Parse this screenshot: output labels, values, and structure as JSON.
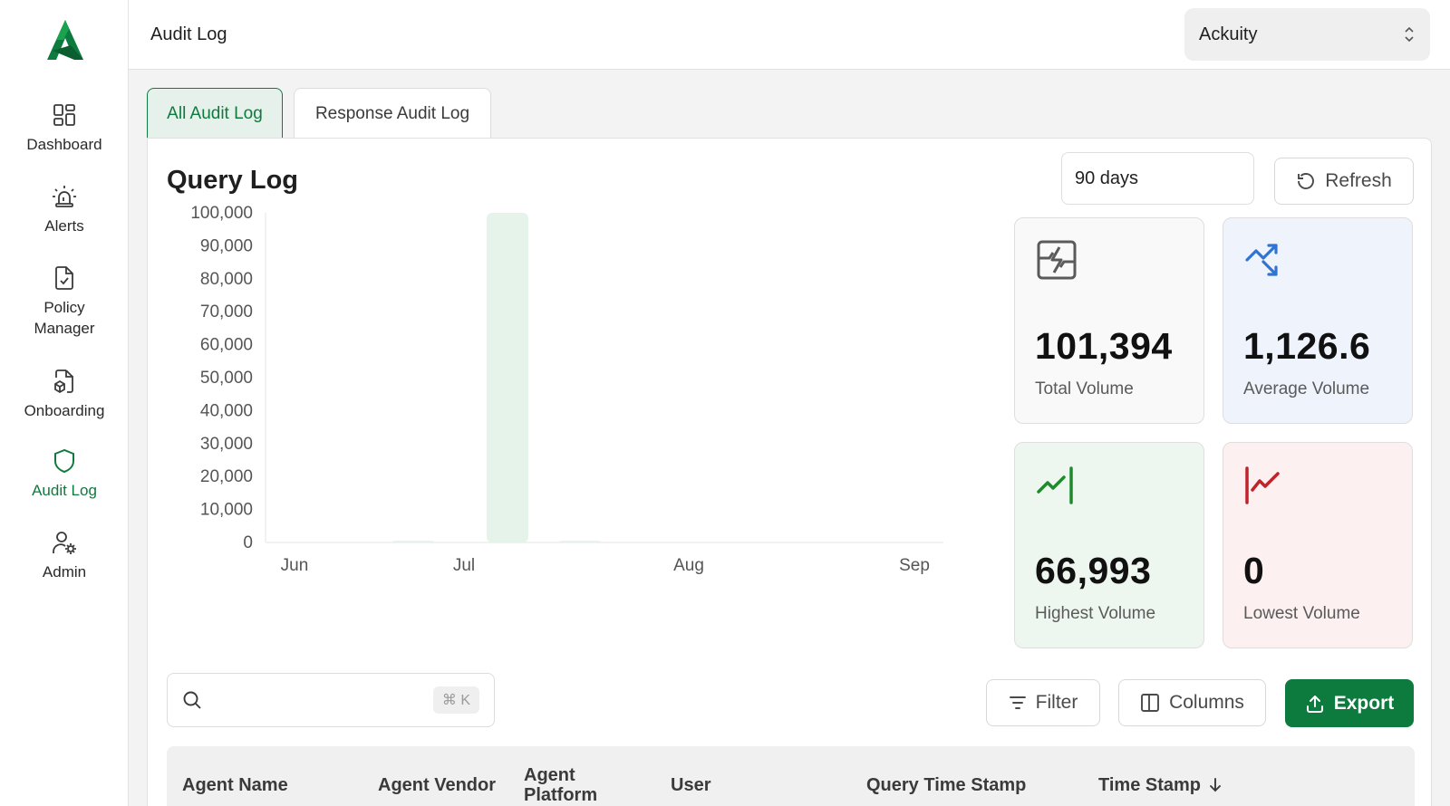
{
  "sidebar": {
    "items": [
      {
        "label": "Dashboard",
        "icon": "grid-icon"
      },
      {
        "label": "Alerts",
        "icon": "siren-icon"
      },
      {
        "label": "Policy Manager",
        "icon": "file-check-icon"
      },
      {
        "label": "Onboarding",
        "icon": "file-box-icon"
      },
      {
        "label": "Audit Log",
        "icon": "shield-icon",
        "active": true
      },
      {
        "label": "Admin",
        "icon": "user-cog-icon"
      }
    ],
    "label_0": "Dashboard",
    "label_1": "Alerts",
    "label_2a": "Policy",
    "label_2b": "Manager",
    "label_3": "Onboarding",
    "label_4": "Audit Log",
    "label_5": "Admin"
  },
  "header": {
    "title": "Audit Log",
    "org": "Ackuity"
  },
  "tabs": [
    {
      "label": "All Audit Log",
      "active": true
    },
    {
      "label": "Response Audit Log",
      "active": false
    }
  ],
  "query_log": {
    "title": "Query Log",
    "range": "90 days",
    "refresh_label": "Refresh"
  },
  "chart_data": {
    "type": "bar",
    "x_tick_labels": [
      "Jun",
      "Jul",
      "Aug",
      "Sep"
    ],
    "y_tick_labels": [
      "0",
      "10,000",
      "20,000",
      "30,000",
      "40,000",
      "50,000",
      "60,000",
      "70,000",
      "80,000",
      "90,000",
      "100,000"
    ],
    "ylim": [
      0,
      100000
    ],
    "bars": [
      {
        "date": "2025-06-22",
        "value": 200
      },
      {
        "date": "2025-07-07",
        "value": 100000
      },
      {
        "date": "2025-07-17",
        "value": 500
      }
    ],
    "x_axis_dates": [
      "2025-06-01",
      "2025-07-01",
      "2025-08-01",
      "2025-09-01"
    ],
    "bar_color": "#e6f3eb",
    "grid": false
  },
  "stats": [
    {
      "value": "101,394",
      "label": "Total Volume",
      "icon": "volume-icon",
      "bg": "#f9f9f9",
      "icon_color": "#5a5a5a"
    },
    {
      "value": "1,126.6",
      "label": "Average Volume",
      "icon": "trend-shuffle-icon",
      "bg": "#eef3fc",
      "icon_color": "#2f74d0"
    },
    {
      "value": "66,993",
      "label": "Highest Volume",
      "icon": "trend-up-icon",
      "bg": "#eef7ef",
      "icon_color": "#1f8a2c"
    },
    {
      "value": "0",
      "label": "Lowest Volume",
      "icon": "trend-down-icon",
      "bg": "#fcf0f0",
      "icon_color": "#c0242a"
    }
  ],
  "toolbar": {
    "search_placeholder": "",
    "shortcut": "⌘ K",
    "filter_label": "Filter",
    "columns_label": "Columns",
    "export_label": "Export"
  },
  "table": {
    "columns": [
      "Agent Name",
      "Agent Vendor",
      "Agent Platform",
      "User",
      "Query Time Stamp",
      "Time Stamp"
    ],
    "col_2a": "Agent",
    "col_2b": "Platform",
    "sort_column": "Time Stamp",
    "sort_direction": "desc"
  },
  "colors": {
    "brand": "#0d7a3e",
    "active_tab_bg": "#e5f1ea"
  }
}
